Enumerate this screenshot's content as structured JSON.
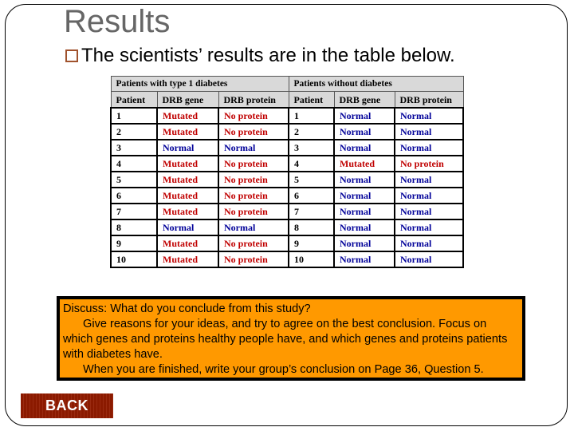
{
  "slide": {
    "title": "Results",
    "bullet": "The scientists’ results are in the table below.",
    "bullet_icon": "hollow-square-bullet"
  },
  "table": {
    "groups": [
      "Patients with type 1 diabetes",
      "Patients without diabetes"
    ],
    "columns": [
      "Patient",
      "DRB gene",
      "DRB protein",
      "Patient",
      "DRB gene",
      "DRB protein"
    ],
    "rows": [
      [
        "1",
        "Mutated",
        "No protein",
        "1",
        "Normal",
        "Normal"
      ],
      [
        "2",
        "Mutated",
        "No protein",
        "2",
        "Normal",
        "Normal"
      ],
      [
        "3",
        "Normal",
        "Normal",
        "3",
        "Normal",
        "Normal"
      ],
      [
        "4",
        "Mutated",
        "No protein",
        "4",
        "Mutated",
        "No protein"
      ],
      [
        "5",
        "Mutated",
        "No protein",
        "5",
        "Normal",
        "Normal"
      ],
      [
        "6",
        "Mutated",
        "No protein",
        "6",
        "Normal",
        "Normal"
      ],
      [
        "7",
        "Mutated",
        "No protein",
        "7",
        "Normal",
        "Normal"
      ],
      [
        "8",
        "Normal",
        "Normal",
        "8",
        "Normal",
        "Normal"
      ],
      [
        "9",
        "Mutated",
        "No protein",
        "9",
        "Normal",
        "Normal"
      ],
      [
        "10",
        "Mutated",
        "No protein",
        "10",
        "Normal",
        "Normal"
      ]
    ],
    "colors": {
      "abnormal": "#c00000",
      "normal": "#000099"
    }
  },
  "discussion": {
    "line1": "Discuss: What do you conclude from this study?",
    "line2": "Give reasons for your ideas, and try to agree on the best conclusion. Focus on which genes and proteins healthy people have, and which genes and proteins patients with diabetes have.",
    "line3": "When you are finished, write your group’s conclusion on Page 36, Question 5.",
    "background": "#ff9900"
  },
  "nav": {
    "back_label": "BACK"
  }
}
